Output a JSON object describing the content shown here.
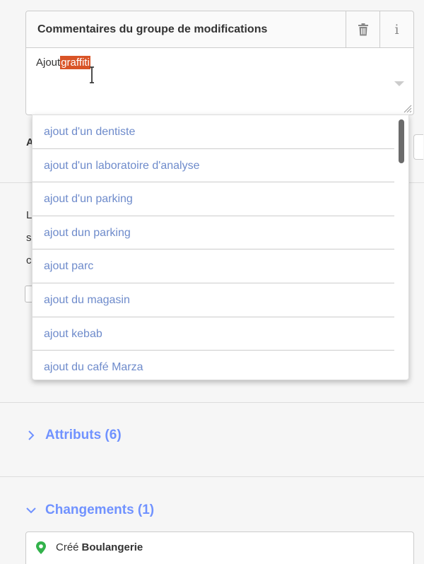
{
  "comment": {
    "title": "Commentaires du groupe de modifications",
    "value_prefix": "Ajout",
    "value_selected": "graffiti"
  },
  "icons": {
    "delete": "trash-icon",
    "info": "info-icon",
    "info_glyph": "i"
  },
  "suggestions": [
    "ajout d'un dentiste",
    "ajout d'un laboratoire d'analyse",
    "ajout d'un parking",
    "ajout dun parking",
    "ajout parc",
    "ajout du magasin",
    "ajout kebab",
    "ajout du café Marza"
  ],
  "background": {
    "letter_a": "A",
    "letter_l": "L",
    "letter_s": "s",
    "letter_c": "c"
  },
  "sections": {
    "attributes": "Attributs (6)",
    "changes": "Changements (1)"
  },
  "change": {
    "verb": "Créé",
    "name": "Boulangerie"
  },
  "colors": {
    "accent": "#7092ff",
    "selection": "#d95427",
    "suggestion_text": "#6e8bcb",
    "pin": "#32b24b"
  }
}
